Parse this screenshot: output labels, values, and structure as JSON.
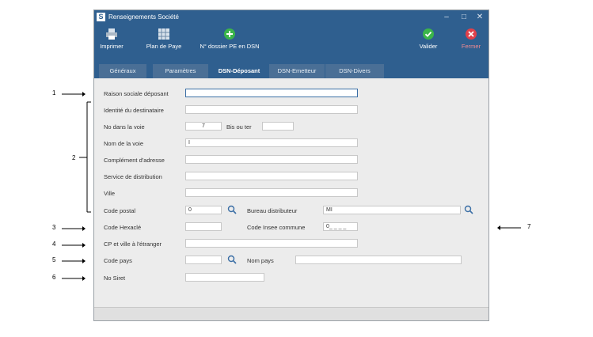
{
  "window": {
    "title": "Renseignements Société",
    "app_icon_letter": "S",
    "controls": [
      "–",
      "□",
      "✕"
    ]
  },
  "toolbar": {
    "print_label": "Imprimer",
    "plan_label": "Plan de Paye",
    "pe_label": "N° dossier PE en DSN",
    "validate_label": "Valider",
    "close_label": "Fermer"
  },
  "tabs": [
    "Généraux",
    "Paramètres",
    "DSN-Déposant",
    "DSN-Emetteur",
    "DSN-Divers"
  ],
  "active_tab": "DSN-Déposant",
  "form": {
    "raison_sociale_label": "Raison sociale déposant",
    "identite_label": "Identité du destinataire",
    "no_voie_label": "No dans la voie",
    "no_voie_value": "7",
    "bis_label": "Bis ou ter",
    "nom_voie_label": "Nom de la voie",
    "nom_voie_value": "I",
    "complement_label": "Complément d'adresse",
    "service_label": "Service de distribution",
    "ville_label": "Ville",
    "code_postal_label": "Code postal",
    "code_postal_value": "0",
    "bureau_label": "Bureau distributeur",
    "bureau_value": "MI",
    "code_hexacle_label": "Code Hexaclé",
    "code_insee_label": "Code Insee commune",
    "code_insee_value": "0_ _ _ _",
    "cp_etranger_label": "CP et ville à l'étranger",
    "code_pays_label": "Code pays",
    "nom_pays_label": "Nom pays",
    "siret_label": "No Siret"
  },
  "callouts": {
    "c1": "1",
    "c2": "2",
    "c3": "3",
    "c4": "4",
    "c5": "5",
    "c6": "6",
    "c7": "7"
  },
  "colors": {
    "primary": "#2f5f8f",
    "validate": "#3bb54a",
    "close": "#e0404a"
  }
}
